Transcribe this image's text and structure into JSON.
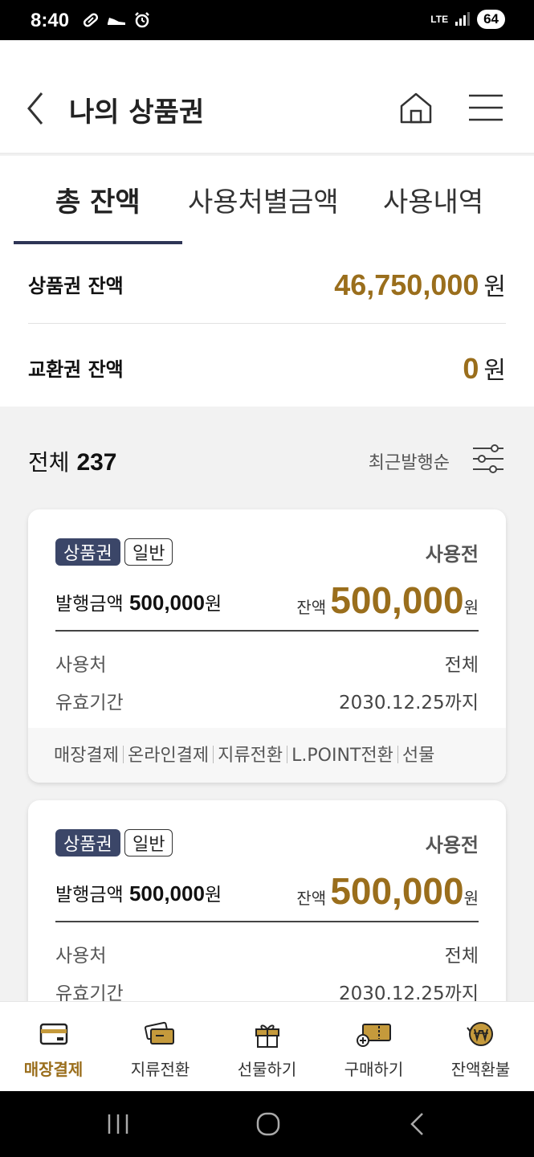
{
  "status_bar": {
    "time": "8:40",
    "network": "LTE",
    "battery": "64"
  },
  "header": {
    "title": "나의 상품권"
  },
  "tabs": [
    {
      "label": "총 잔액"
    },
    {
      "label": "사용처별금액"
    },
    {
      "label": "사용내역"
    }
  ],
  "balances": [
    {
      "label": "상품권 잔액",
      "amount": "46,750,000",
      "unit": "원"
    },
    {
      "label": "교환권 잔액",
      "amount": "0",
      "unit": "원"
    }
  ],
  "list": {
    "total_label": "전체",
    "total_count": "237",
    "sort_label": "최근발행순"
  },
  "vouchers": [
    {
      "type_badge": "상품권",
      "kind_badge": "일반",
      "status": "사용전",
      "issue_label": "발행금액",
      "issue_amount": "500,000",
      "issue_unit": "원",
      "remain_label": "잔액",
      "remain_amount": "500,000",
      "remain_unit": "원",
      "place_label": "사용처",
      "place_value": "전체",
      "period_label": "유효기간",
      "period_value": "2030.12.25까지",
      "actions": [
        "매장결제",
        "온라인결제",
        "지류전환",
        "L.POINT전환",
        "선물"
      ]
    },
    {
      "type_badge": "상품권",
      "kind_badge": "일반",
      "status": "사용전",
      "issue_label": "발행금액",
      "issue_amount": "500,000",
      "issue_unit": "원",
      "remain_label": "잔액",
      "remain_amount": "500,000",
      "remain_unit": "원",
      "place_label": "사용처",
      "place_value": "전체",
      "period_label": "유효기간",
      "period_value": "2030.12.25까지"
    }
  ],
  "bottom_nav": [
    {
      "label": "매장결제",
      "icon": "card-payment-icon",
      "active": true
    },
    {
      "label": "지류전환",
      "icon": "paper-voucher-icon"
    },
    {
      "label": "선물하기",
      "icon": "gift-icon"
    },
    {
      "label": "구매하기",
      "icon": "ticket-purchase-icon"
    },
    {
      "label": "잔액환불",
      "icon": "won-refund-icon"
    }
  ],
  "colors": {
    "accent_gold": "#9a6e1c",
    "navy": "#2e3556",
    "badge_navy": "#3b4668"
  }
}
